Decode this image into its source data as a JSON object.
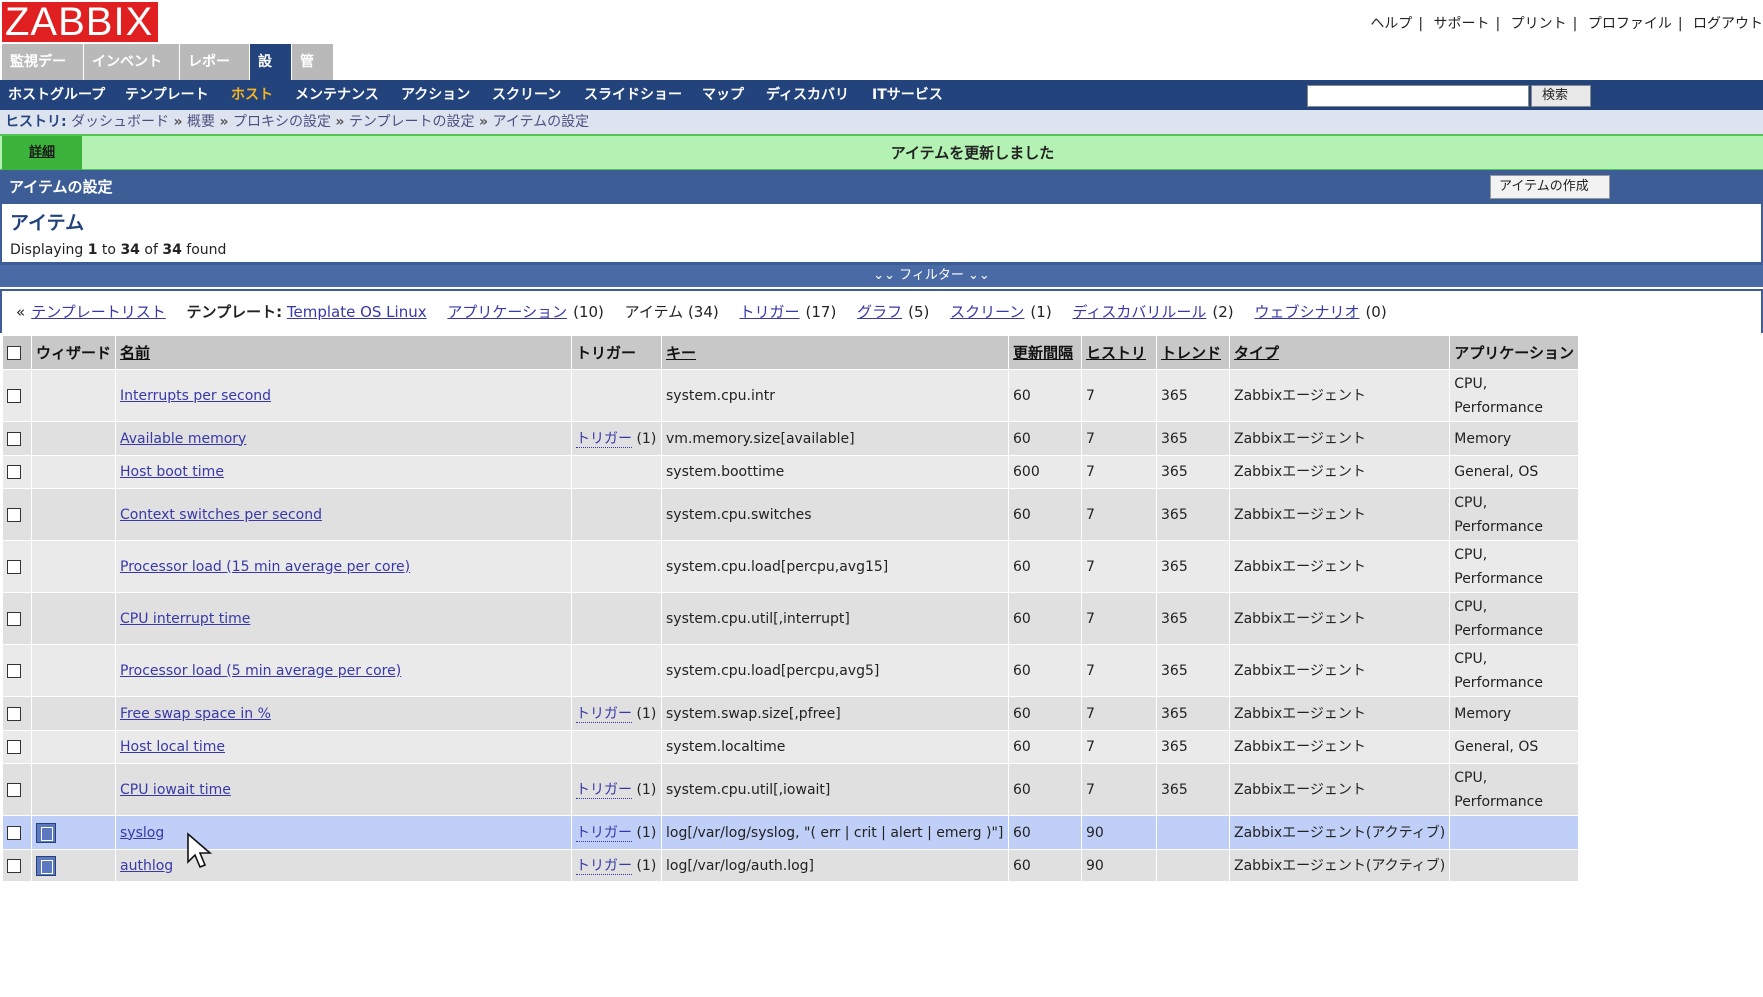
{
  "logo": "ZABBIX",
  "topnav": [
    "ヘルプ",
    "サポート",
    "プリント",
    "プロファイル",
    "ログアウト"
  ],
  "mainmenu": [
    "監視データ",
    "インベントリ",
    "レポート",
    "設定",
    "管理"
  ],
  "submenu": [
    "ホストグループ",
    "テンプレート",
    "ホスト",
    "メンテナンス",
    "アクション",
    "スクリーン",
    "スライドショー",
    "マップ",
    "ディスカバリ",
    "ITサービス"
  ],
  "search": {
    "button": "検索"
  },
  "history": {
    "label": "ヒストリ:",
    "items": [
      "ダッシュボード",
      "概要",
      "プロキシの設定",
      "テンプレートの設定",
      "アイテムの設定"
    ],
    "sep": "»"
  },
  "message": {
    "details": "詳細",
    "text": "アイテムを更新しました"
  },
  "page": {
    "title": "アイテムの設定",
    "create_button": "アイテムの作成"
  },
  "summary": {
    "title": "アイテム",
    "prefix": "Displaying",
    "from": "1",
    "to_word": "to",
    "to": "34",
    "of_word": "of",
    "total": "34",
    "suffix": "found"
  },
  "filter": {
    "label": "フィルター"
  },
  "tplnav": {
    "back": "テンプレートリスト",
    "template_label": "テンプレート:",
    "template_name": "Template OS Linux",
    "apps": "アプリケーション",
    "apps_count": "(10)",
    "items": "アイテム (34)",
    "triggers": "トリガー",
    "triggers_count": "(17)",
    "graphs": "グラフ",
    "graphs_count": "(5)",
    "screens": "スクリーン",
    "screens_count": "(1)",
    "discovery": "ディスカバリルール",
    "discovery_count": "(2)",
    "web": "ウェブシナリオ",
    "web_count": "(0)"
  },
  "table": {
    "headers": {
      "wizard": "ウィザード",
      "name": "名前",
      "triggers": "トリガー",
      "key": "キー",
      "interval": "更新間隔",
      "history": "ヒストリ",
      "trends": "トレンド",
      "type": "タイプ",
      "applications": "アプリケーション"
    },
    "trigger_link": "トリガー",
    "rows": [
      {
        "name": "Interrupts per second",
        "triggers": "",
        "key": "system.cpu.intr",
        "interval": "60",
        "history": "7",
        "trends": "365",
        "type": "Zabbixエージェント",
        "apps": [
          "CPU,",
          "Performance"
        ],
        "wizard": false
      },
      {
        "name": "Available memory",
        "triggers": "(1)",
        "key": "vm.memory.size[available]",
        "interval": "60",
        "history": "7",
        "trends": "365",
        "type": "Zabbixエージェント",
        "apps": [
          "Memory"
        ],
        "wizard": false
      },
      {
        "name": "Host boot time",
        "triggers": "",
        "key": "system.boottime",
        "interval": "600",
        "history": "7",
        "trends": "365",
        "type": "Zabbixエージェント",
        "apps": [
          "General, OS"
        ],
        "wizard": false
      },
      {
        "name": "Context switches per second",
        "triggers": "",
        "key": "system.cpu.switches",
        "interval": "60",
        "history": "7",
        "trends": "365",
        "type": "Zabbixエージェント",
        "apps": [
          "CPU,",
          "Performance"
        ],
        "wizard": false
      },
      {
        "name": "Processor load (15 min average per core)",
        "triggers": "",
        "key": "system.cpu.load[percpu,avg15]",
        "interval": "60",
        "history": "7",
        "trends": "365",
        "type": "Zabbixエージェント",
        "apps": [
          "CPU,",
          "Performance"
        ],
        "wizard": false
      },
      {
        "name": "CPU interrupt time",
        "triggers": "",
        "key": "system.cpu.util[,interrupt]",
        "interval": "60",
        "history": "7",
        "trends": "365",
        "type": "Zabbixエージェント",
        "apps": [
          "CPU,",
          "Performance"
        ],
        "wizard": false
      },
      {
        "name": "Processor load (5 min average per core)",
        "triggers": "",
        "key": "system.cpu.load[percpu,avg5]",
        "interval": "60",
        "history": "7",
        "trends": "365",
        "type": "Zabbixエージェント",
        "apps": [
          "CPU,",
          "Performance"
        ],
        "wizard": false
      },
      {
        "name": "Free swap space in %",
        "triggers": "(1)",
        "key": "system.swap.size[,pfree]",
        "interval": "60",
        "history": "7",
        "trends": "365",
        "type": "Zabbixエージェント",
        "apps": [
          "Memory"
        ],
        "wizard": false
      },
      {
        "name": "Host local time",
        "triggers": "",
        "key": "system.localtime",
        "interval": "60",
        "history": "7",
        "trends": "365",
        "type": "Zabbixエージェント",
        "apps": [
          "General, OS"
        ],
        "wizard": false
      },
      {
        "name": "CPU iowait time",
        "triggers": "(1)",
        "key": "system.cpu.util[,iowait]",
        "interval": "60",
        "history": "7",
        "trends": "365",
        "type": "Zabbixエージェント",
        "apps": [
          "CPU,",
          "Performance"
        ],
        "wizard": false
      },
      {
        "name": "syslog",
        "triggers": "(1)",
        "key": "log[/var/log/syslog, \"( err | crit | alert | emerg )\"]",
        "interval": "60",
        "history": "90",
        "trends": "",
        "type": "Zabbixエージェント(アクティブ)",
        "apps": [
          ""
        ],
        "wizard": true,
        "selected": true
      },
      {
        "name": "authlog",
        "triggers": "(1)",
        "key": "log[/var/log/auth.log]",
        "interval": "60",
        "history": "90",
        "trends": "",
        "type": "Zabbixエージェント(アクティブ)",
        "apps": [
          ""
        ],
        "wizard": true
      }
    ]
  }
}
